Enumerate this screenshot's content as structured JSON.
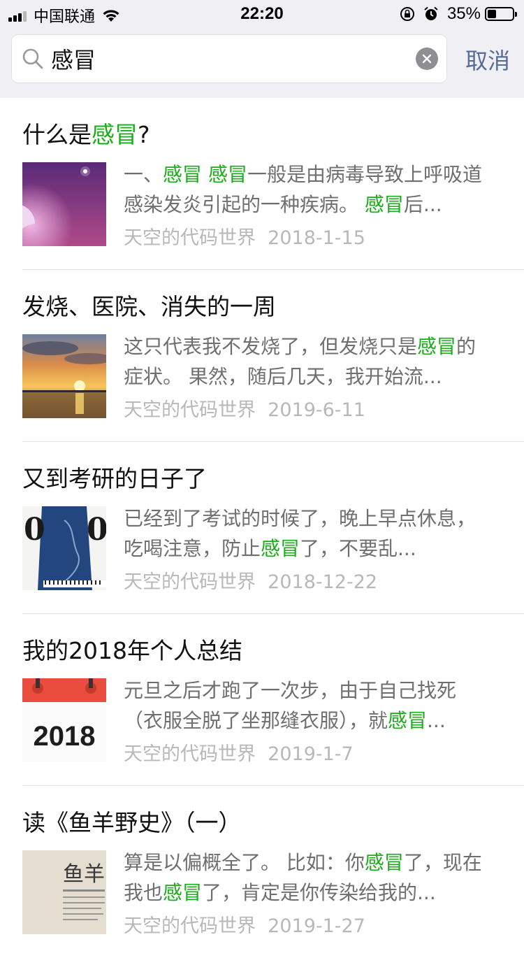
{
  "status_bar": {
    "carrier": "中国联通",
    "time": "22:20",
    "battery": "35%",
    "battery_level": 0.35,
    "icons": [
      "signal-icon",
      "wifi-icon",
      "rotation-lock-icon",
      "alarm-icon",
      "battery-icon"
    ]
  },
  "search": {
    "query": "感冒",
    "placeholder": "",
    "cancel_label": "取消"
  },
  "highlight_color": "#1aad19",
  "accent_color": "#576b95",
  "results": [
    {
      "title_parts": [
        {
          "text": "什么是",
          "hl": false
        },
        {
          "text": "感冒",
          "hl": true
        },
        {
          "text": "?",
          "hl": false
        }
      ],
      "snippet_parts": [
        {
          "text": "一、",
          "hl": false
        },
        {
          "text": "感冒",
          "hl": true
        },
        {
          "text": " ",
          "hl": false
        },
        {
          "text": "感冒",
          "hl": true
        },
        {
          "text": "一般是由病毒导致上呼吸道感染发炎引起的一种疾病。 ",
          "hl": false
        },
        {
          "text": "感冒",
          "hl": true
        },
        {
          "text": "后...",
          "hl": false
        }
      ],
      "author": "天空的代码世界",
      "date": "2018-1-15",
      "thumbnail": "night-sky-thumbnail"
    },
    {
      "title_parts": [
        {
          "text": "发烧、医院、消失的一周",
          "hl": false
        }
      ],
      "snippet_parts": [
        {
          "text": "这只代表我不发烧了，但发烧只是",
          "hl": false
        },
        {
          "text": "感冒",
          "hl": true
        },
        {
          "text": "的症状。 果然，随后几天，我开始流...",
          "hl": false
        }
      ],
      "author": "天空的代码世界",
      "date": "2019-6-11",
      "thumbnail": "sunset-thumbnail"
    },
    {
      "title_parts": [
        {
          "text": "又到考研的日子了",
          "hl": false
        }
      ],
      "snippet_parts": [
        {
          "text": "已经到了考试的时候了，晚上早点休息，吃喝注意，防止",
          "hl": false
        },
        {
          "text": "感冒",
          "hl": true
        },
        {
          "text": "了，不要乱...",
          "hl": false
        }
      ],
      "author": "天空的代码世界",
      "date": "2018-12-22",
      "thumbnail": "piano-poster-thumbnail"
    },
    {
      "title_parts": [
        {
          "text": "我的2018年个人总结",
          "hl": false
        }
      ],
      "snippet_parts": [
        {
          "text": "元旦之后才跑了一次步，由于自己找死（衣服全脱了坐那缝衣服），就",
          "hl": false
        },
        {
          "text": "感冒",
          "hl": true
        },
        {
          "text": "...",
          "hl": false
        }
      ],
      "author": "天空的代码世界",
      "date": "2019-1-7",
      "thumbnail": "calendar-2018-thumbnail",
      "thumbnail_text": "2018"
    },
    {
      "title_parts": [
        {
          "text": "读《鱼羊野史》（一）",
          "hl": false
        }
      ],
      "snippet_parts": [
        {
          "text": "算是以偏概全了。 比如：你",
          "hl": false
        },
        {
          "text": "感冒",
          "hl": true
        },
        {
          "text": "了，现在我也",
          "hl": false
        },
        {
          "text": "感冒",
          "hl": true
        },
        {
          "text": "了，肯定是你传染给我的...",
          "hl": false
        }
      ],
      "author": "天空的代码世界",
      "date": "2019-1-27",
      "thumbnail": "book-cover-thumbnail",
      "thumbnail_text": "鱼羊"
    }
  ]
}
